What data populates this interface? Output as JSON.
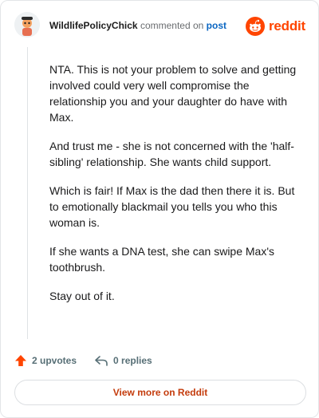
{
  "header": {
    "username": "WildlifePolicyChick",
    "action_text": "commented on",
    "post_link": "post",
    "brand": "reddit",
    "brand_color": "#ff4500"
  },
  "comment": {
    "paragraphs": [
      "NTA. This is not your problem to solve and getting involved could very well compromise the relationship you and your daughter do have with Max.",
      "And trust me - she is not concerned with the 'half-sibling' relationship. She wants child support.",
      "Which is fair! If Max is the dad then there it is. But to emotionally blackmail you tells you who this woman is.",
      "If she wants a DNA test, she can swipe Max's toothbrush.",
      "Stay out of it."
    ]
  },
  "actions": {
    "upvotes": "2 upvotes",
    "replies": "0 replies",
    "upvote_icon": "upvote-arrow-icon",
    "reply_icon": "reply-arrow-icon"
  },
  "footer": {
    "view_more": "View more on Reddit"
  }
}
